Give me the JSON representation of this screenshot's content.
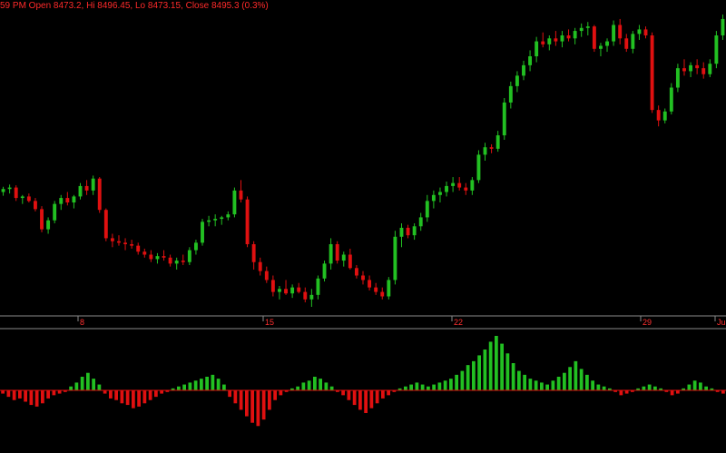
{
  "header": {
    "ohlc_text": "59 PM Open 8473.2, Hi 8496.45, Lo 8473.15, Close 8495.3 (0.3%)"
  },
  "colors": {
    "background": "#000000",
    "up": "#22c022",
    "down": "#e01010",
    "axis_line": "#8a8a8a",
    "tick_text": "#ff3030",
    "header_text": "#ff2a2a"
  },
  "chart_data": [
    {
      "type": "candlestick",
      "x_tick_labels": [
        "8",
        "15",
        "22",
        "29",
        "Ju"
      ],
      "ohlc": [
        [
          8474,
          8481,
          8469,
          8478
        ],
        [
          8478,
          8484,
          8472,
          8480
        ],
        [
          8480,
          8483,
          8462,
          8466
        ],
        [
          8466,
          8470,
          8458,
          8468
        ],
        [
          8468,
          8472,
          8460,
          8462
        ],
        [
          8462,
          8466,
          8448,
          8451
        ],
        [
          8451,
          8455,
          8420,
          8424
        ],
        [
          8424,
          8440,
          8418,
          8436
        ],
        [
          8436,
          8462,
          8432,
          8458
        ],
        [
          8458,
          8470,
          8450,
          8466
        ],
        [
          8466,
          8474,
          8456,
          8460
        ],
        [
          8460,
          8470,
          8452,
          8468
        ],
        [
          8468,
          8486,
          8464,
          8482
        ],
        [
          8482,
          8490,
          8470,
          8476
        ],
        [
          8476,
          8496,
          8470,
          8492
        ],
        [
          8492,
          8494,
          8446,
          8450
        ],
        [
          8450,
          8452,
          8408,
          8412
        ],
        [
          8412,
          8418,
          8400,
          8408
        ],
        [
          8408,
          8416,
          8402,
          8406
        ],
        [
          8406,
          8412,
          8396,
          8404
        ],
        [
          8404,
          8410,
          8398,
          8402
        ],
        [
          8402,
          8406,
          8390,
          8394
        ],
        [
          8394,
          8398,
          8386,
          8390
        ],
        [
          8390,
          8396,
          8380,
          8384
        ],
        [
          8384,
          8392,
          8378,
          8388
        ],
        [
          8388,
          8396,
          8382,
          8386
        ],
        [
          8386,
          8390,
          8374,
          8378
        ],
        [
          8378,
          8386,
          8370,
          8382
        ],
        [
          8382,
          8390,
          8376,
          8380
        ],
        [
          8380,
          8400,
          8376,
          8396
        ],
        [
          8396,
          8410,
          8390,
          8406
        ],
        [
          8406,
          8438,
          8402,
          8434
        ],
        [
          8434,
          8442,
          8428,
          8436
        ],
        [
          8436,
          8444,
          8428,
          8438
        ],
        [
          8438,
          8442,
          8430,
          8440
        ],
        [
          8440,
          8448,
          8436,
          8444
        ],
        [
          8444,
          8480,
          8440,
          8476
        ],
        [
          8476,
          8490,
          8460,
          8464
        ],
        [
          8464,
          8468,
          8400,
          8404
        ],
        [
          8404,
          8408,
          8370,
          8380
        ],
        [
          8380,
          8386,
          8362,
          8368
        ],
        [
          8368,
          8374,
          8352,
          8356
        ],
        [
          8356,
          8362,
          8334,
          8340
        ],
        [
          8340,
          8348,
          8330,
          8344
        ],
        [
          8344,
          8356,
          8336,
          8338
        ],
        [
          8338,
          8350,
          8332,
          8346
        ],
        [
          8346,
          8352,
          8338,
          8340
        ],
        [
          8340,
          8346,
          8326,
          8330
        ],
        [
          8330,
          8344,
          8320,
          8336
        ],
        [
          8336,
          8362,
          8330,
          8358
        ],
        [
          8358,
          8382,
          8354,
          8378
        ],
        [
          8378,
          8412,
          8370,
          8404
        ],
        [
          8404,
          8408,
          8378,
          8382
        ],
        [
          8382,
          8394,
          8374,
          8390
        ],
        [
          8390,
          8398,
          8370,
          8372
        ],
        [
          8372,
          8376,
          8358,
          8362
        ],
        [
          8362,
          8368,
          8350,
          8356
        ],
        [
          8356,
          8362,
          8342,
          8346
        ],
        [
          8346,
          8352,
          8336,
          8340
        ],
        [
          8340,
          8346,
          8330,
          8334
        ],
        [
          8334,
          8360,
          8330,
          8356
        ],
        [
          8356,
          8422,
          8350,
          8414
        ],
        [
          8414,
          8432,
          8400,
          8426
        ],
        [
          8426,
          8430,
          8412,
          8416
        ],
        [
          8416,
          8432,
          8410,
          8428
        ],
        [
          8428,
          8446,
          8422,
          8440
        ],
        [
          8440,
          8470,
          8434,
          8462
        ],
        [
          8462,
          8476,
          8452,
          8470
        ],
        [
          8470,
          8480,
          8460,
          8474
        ],
        [
          8474,
          8488,
          8468,
          8482
        ],
        [
          8482,
          8494,
          8474,
          8486
        ],
        [
          8486,
          8494,
          8476,
          8480
        ],
        [
          8480,
          8486,
          8470,
          8476
        ],
        [
          8476,
          8494,
          8470,
          8490
        ],
        [
          8490,
          8530,
          8486,
          8524
        ],
        [
          8524,
          8540,
          8516,
          8534
        ],
        [
          8534,
          8538,
          8526,
          8532
        ],
        [
          8532,
          8556,
          8528,
          8550
        ],
        [
          8550,
          8600,
          8544,
          8594
        ],
        [
          8594,
          8622,
          8586,
          8616
        ],
        [
          8616,
          8636,
          8608,
          8630
        ],
        [
          8630,
          8650,
          8624,
          8644
        ],
        [
          8644,
          8664,
          8636,
          8656
        ],
        [
          8656,
          8682,
          8648,
          8676
        ],
        [
          8676,
          8688,
          8668,
          8672
        ],
        [
          8672,
          8684,
          8664,
          8680
        ],
        [
          8680,
          8690,
          8670,
          8676
        ],
        [
          8676,
          8690,
          8668,
          8684
        ],
        [
          8684,
          8692,
          8676,
          8680
        ],
        [
          8680,
          8694,
          8672,
          8690
        ],
        [
          8690,
          8700,
          8682,
          8694
        ],
        [
          8694,
          8702,
          8684,
          8696
        ],
        [
          8696,
          8698,
          8662,
          8666
        ],
        [
          8666,
          8674,
          8656,
          8670
        ],
        [
          8670,
          8680,
          8662,
          8676
        ],
        [
          8676,
          8704,
          8670,
          8698
        ],
        [
          8698,
          8706,
          8672,
          8680
        ],
        [
          8680,
          8686,
          8662,
          8666
        ],
        [
          8666,
          8690,
          8660,
          8686
        ],
        [
          8686,
          8698,
          8678,
          8692
        ],
        [
          8692,
          8696,
          8680,
          8684
        ],
        [
          8684,
          8688,
          8580,
          8584
        ],
        [
          8584,
          8590,
          8562,
          8570
        ],
        [
          8570,
          8586,
          8566,
          8582
        ],
        [
          8582,
          8620,
          8578,
          8614
        ],
        [
          8614,
          8646,
          8608,
          8640
        ],
        [
          8640,
          8652,
          8630,
          8636
        ],
        [
          8636,
          8648,
          8628,
          8644
        ],
        [
          8644,
          8652,
          8632,
          8640
        ],
        [
          8640,
          8648,
          8626,
          8632
        ],
        [
          8632,
          8652,
          8628,
          8646
        ],
        [
          8646,
          8690,
          8640,
          8684
        ],
        [
          8684,
          8712,
          8678,
          8706
        ]
      ],
      "histogram": [
        -2,
        -4,
        -6,
        -5,
        -7,
        -9,
        -10,
        -8,
        -5,
        -3,
        -2,
        -1,
        2,
        4,
        7,
        9,
        6,
        3,
        -2,
        -5,
        -6,
        -8,
        -9,
        -11,
        -10,
        -8,
        -6,
        -4,
        -2,
        -1,
        1,
        2,
        3,
        4,
        5,
        6,
        7,
        8,
        6,
        3,
        -4,
        -8,
        -12,
        -16,
        -20,
        -22,
        -18,
        -12,
        -6,
        -3,
        -1,
        1,
        2,
        4,
        5,
        7,
        6,
        4,
        2,
        -1,
        -3,
        -6,
        -9,
        -12,
        -14,
        -11,
        -8,
        -5,
        -3,
        -1,
        1,
        2,
        3,
        4,
        3,
        2,
        3,
        4,
        5,
        6,
        8,
        10,
        13,
        15,
        18,
        21,
        25,
        28,
        24,
        19,
        14,
        10,
        8,
        6,
        5,
        4,
        3,
        5,
        7,
        9,
        12,
        15,
        11,
        8,
        5,
        3,
        2,
        1,
        -1,
        -3,
        -2,
        -1,
        1,
        2,
        3,
        2,
        1,
        -1,
        -3,
        -2,
        1,
        3,
        5,
        4,
        2,
        1,
        -1,
        -2
      ]
    }
  ]
}
